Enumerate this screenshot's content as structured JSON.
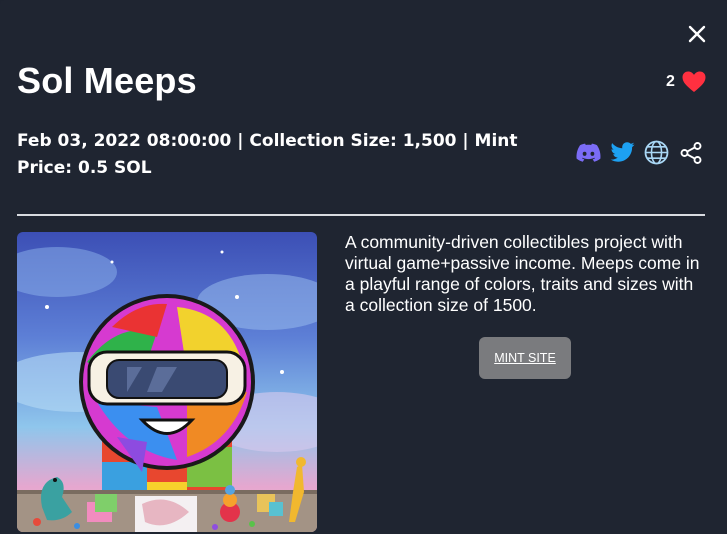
{
  "modal": {
    "title": "Sol Meeps",
    "like_count": "2",
    "meta_line": "Feb 03, 2022 08:00:00 | Collection Size: 1,500 | Mint Price: 0.5 SOL",
    "social_icons": [
      "discord-icon",
      "twitter-icon",
      "globe-icon",
      "share-icon"
    ],
    "description": "A community-driven collectibles project with virtual game+passive income. Meeps come in a playful range of colors, traits and sizes with a collection size of 1500.",
    "mint_button_label": "MINT SITE",
    "image_alt_icon": "nft-artwork"
  },
  "colors": {
    "background": "#1f2531",
    "heart": "#ff3040",
    "discord": "#7b6cf6",
    "twitter": "#1da1f2",
    "globe": "#a9d7f5",
    "mint_button": "#7a7b7e"
  }
}
